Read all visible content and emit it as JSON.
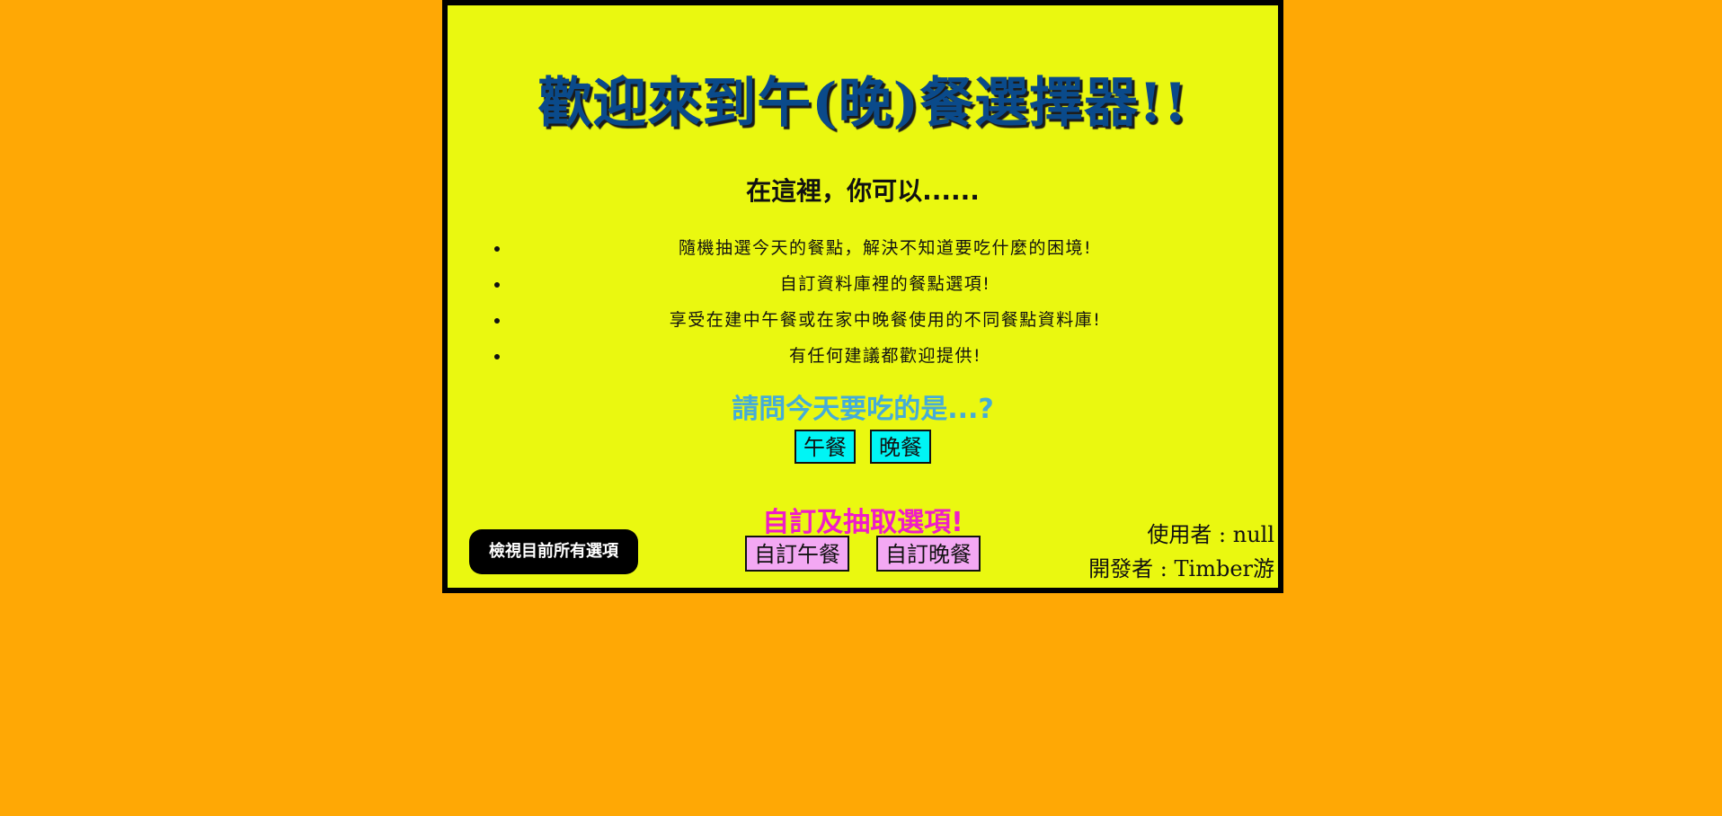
{
  "header": {
    "title": "歡迎來到午(晚)餐選擇器!!",
    "subtitle": "在這裡，你可以......"
  },
  "features": [
    "隨機抽選今天的餐點，解決不知道要吃什麼的困境!",
    "自訂資料庫裡的餐點選項!",
    "享受在建中午餐或在家中晚餐使用的不同餐點資料庫!",
    "有任何建議都歡迎提供!"
  ],
  "meal_select": {
    "question": "請問今天要吃的是...?",
    "lunch_label": "午餐",
    "dinner_label": "晚餐"
  },
  "custom": {
    "title": "自訂及抽取選項!",
    "lunch_label": "自訂午餐",
    "dinner_label": "自訂晚餐"
  },
  "view_all_label": "檢視目前所有選項",
  "info": {
    "user": "使用者 : null",
    "developer": "開發者 : Timber游"
  },
  "colors": {
    "page_background": "#FFA805",
    "panel_background": "#EAF810",
    "title": "#0A4A8A",
    "question": "#45ACD8",
    "custom_title": "#F01CC8",
    "meal_button": "#00F5F5",
    "custom_button": "#F3A8F3"
  }
}
